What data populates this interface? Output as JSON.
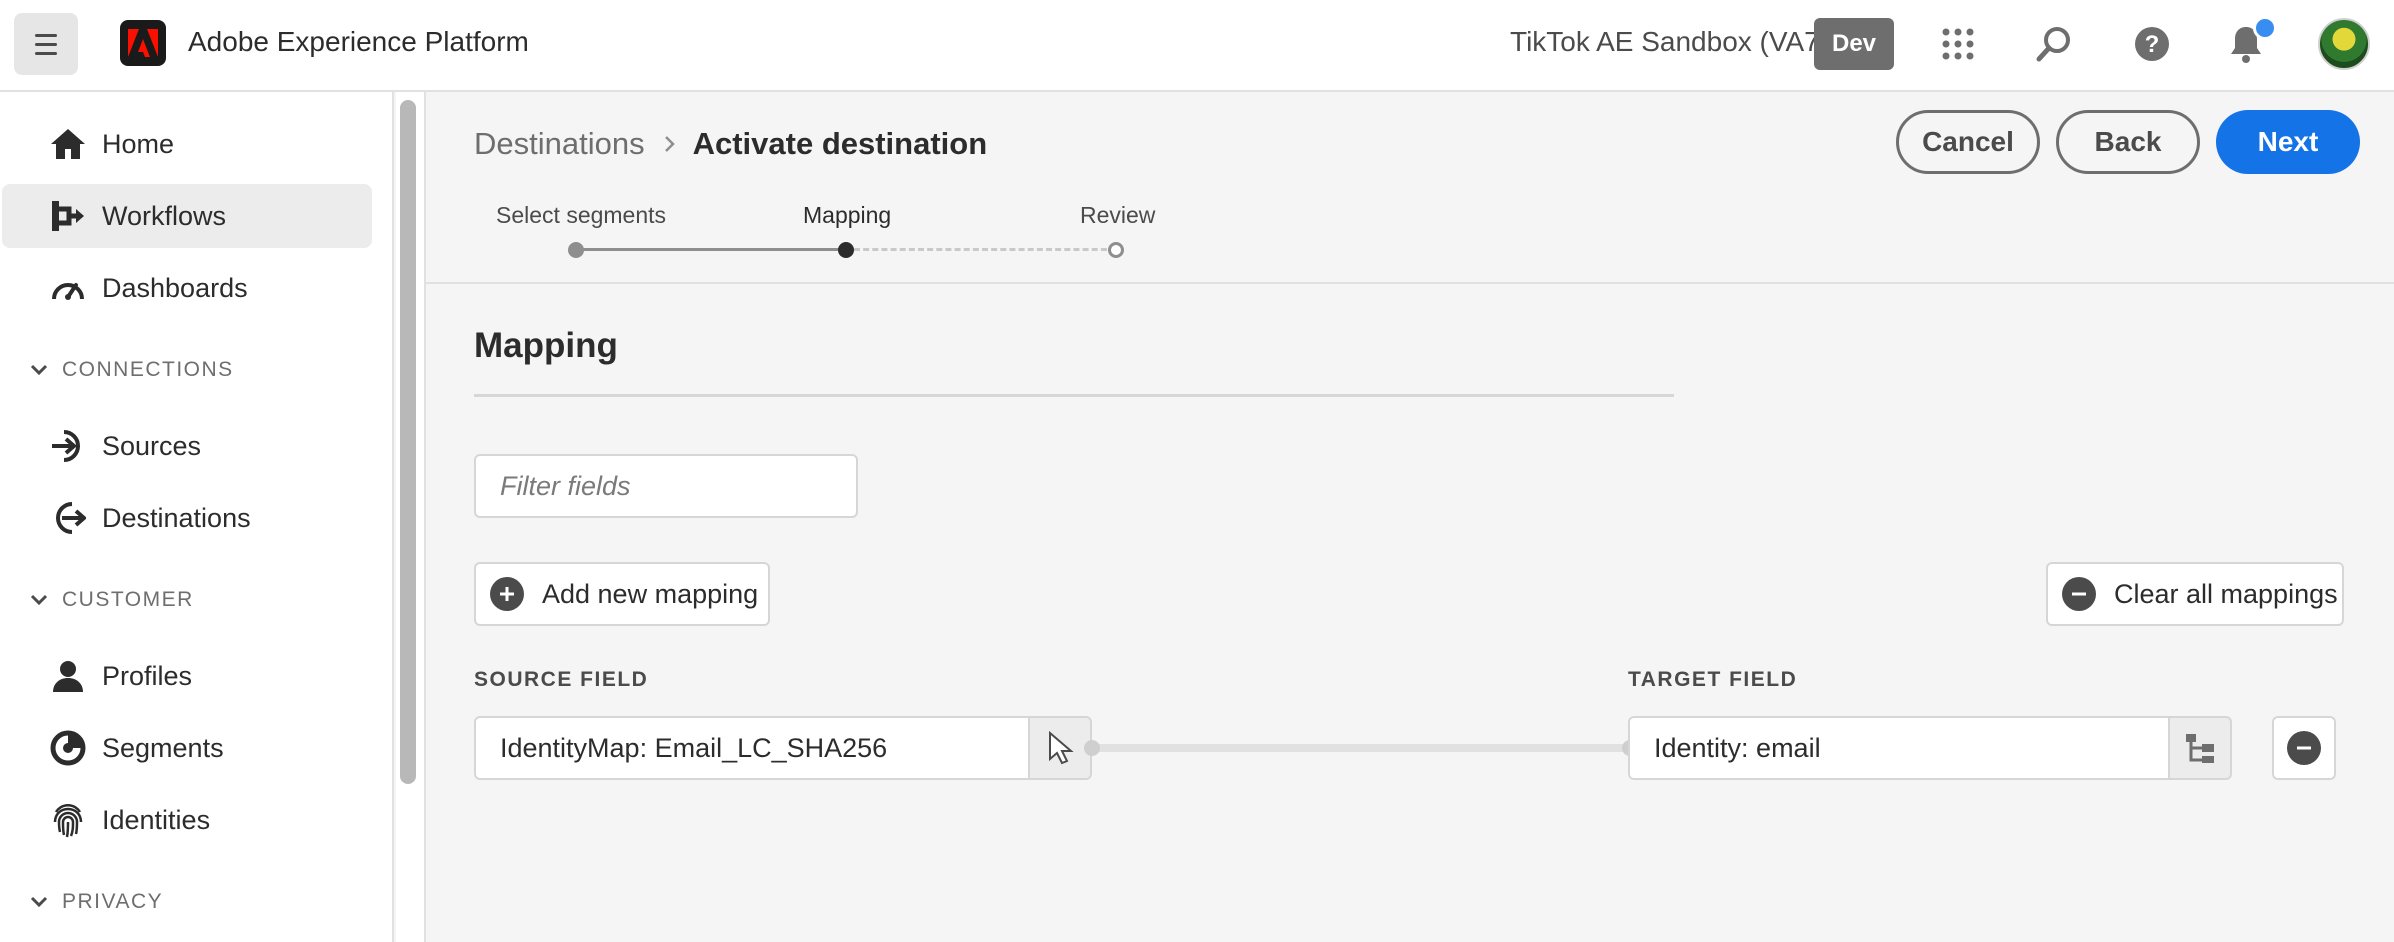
{
  "header": {
    "app_title": "Adobe Experience Platform",
    "sandbox_name": "TikTok AE Sandbox (VA7)",
    "env_badge": "Dev",
    "icons": [
      "apps-grid-icon",
      "search-icon",
      "help-icon",
      "bell-icon"
    ]
  },
  "sidebar": {
    "items": [
      {
        "label": "Home",
        "icon": "home-icon"
      },
      {
        "label": "Workflows",
        "icon": "workflow-icon",
        "active": true
      },
      {
        "label": "Dashboards",
        "icon": "dashboard-icon"
      }
    ],
    "sections": [
      {
        "title": "CONNECTIONS",
        "items": [
          {
            "label": "Sources",
            "icon": "sources-icon"
          },
          {
            "label": "Destinations",
            "icon": "destinations-icon"
          }
        ]
      },
      {
        "title": "CUSTOMER",
        "items": [
          {
            "label": "Profiles",
            "icon": "profile-icon"
          },
          {
            "label": "Segments",
            "icon": "segments-icon"
          },
          {
            "label": "Identities",
            "icon": "fingerprint-icon"
          }
        ]
      },
      {
        "title": "PRIVACY",
        "items": []
      }
    ]
  },
  "breadcrumb": {
    "parent": "Destinations",
    "current": "Activate destination"
  },
  "actions": {
    "cancel": "Cancel",
    "back": "Back",
    "next": "Next"
  },
  "steps": [
    {
      "label": "Select segments",
      "state": "complete"
    },
    {
      "label": "Mapping",
      "state": "current"
    },
    {
      "label": "Review",
      "state": "pending"
    }
  ],
  "mapping": {
    "title": "Mapping",
    "filter_placeholder": "Filter fields",
    "add_label": "Add new mapping",
    "clear_label": "Clear all mappings",
    "source_header": "SOURCE FIELD",
    "target_header": "TARGET FIELD",
    "rows": [
      {
        "source": "IdentityMap: Email_LC_SHA256",
        "target": "Identity: email"
      }
    ]
  },
  "colors": {
    "primary": "#1473e6",
    "notification": "#378ef0",
    "adobe_red": "#fa0f00"
  }
}
